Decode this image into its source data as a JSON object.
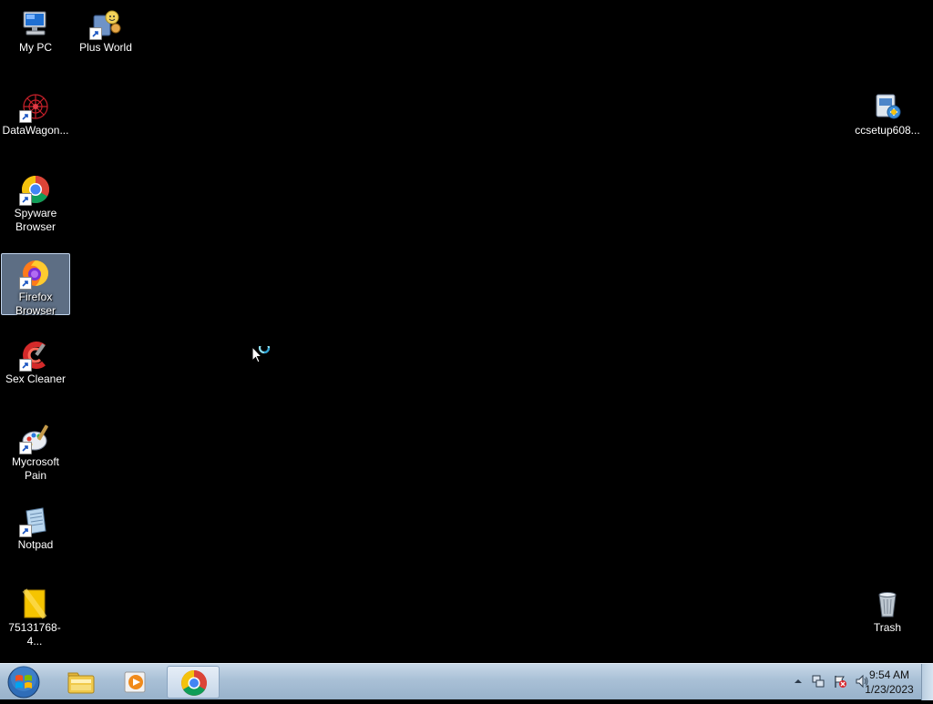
{
  "desktop": {
    "icons": [
      {
        "label": "My PC",
        "icon": "computer-icon"
      },
      {
        "label": "Plus World",
        "icon": "game-icon",
        "shortcut": true
      },
      {
        "label": "DataWagon...",
        "icon": "datawagon-icon",
        "shortcut": true
      },
      {
        "label": "Spyware Browser",
        "icon": "chrome-icon",
        "shortcut": true
      },
      {
        "label": "Firefox Browser",
        "icon": "firefox-icon",
        "shortcut": true,
        "selected": true
      },
      {
        "label": "Sex Cleaner",
        "icon": "ccleaner-icon",
        "shortcut": true
      },
      {
        "label": "Mycrosoft Pain",
        "icon": "paint-icon",
        "shortcut": true
      },
      {
        "label": "Notpad",
        "icon": "notepad-icon",
        "shortcut": true
      },
      {
        "label": "75131768-4...",
        "icon": "image-file-icon"
      },
      {
        "label": "ccsetup608...",
        "icon": "installer-icon"
      },
      {
        "label": "Trash",
        "icon": "recycle-bin-icon"
      }
    ]
  },
  "taskbar": {
    "start": {
      "icon": "windows-start-icon"
    },
    "pinned": [
      {
        "name": "File Explorer",
        "icon": "folder-icon",
        "active": false
      },
      {
        "name": "Media Player",
        "icon": "media-player-icon",
        "active": false
      },
      {
        "name": "Google Chrome",
        "icon": "chrome-icon",
        "active": true
      }
    ],
    "tray": {
      "icons": [
        "show-hidden-icons-arrow",
        "network-icon",
        "action-center-flag-icon",
        "volume-icon"
      ],
      "time": "9:54 AM",
      "date": "1/23/2023"
    }
  },
  "colors": {
    "desktop_background": "#000000",
    "taskbar": "#a9c0d6",
    "selection": "#aac8f0"
  }
}
